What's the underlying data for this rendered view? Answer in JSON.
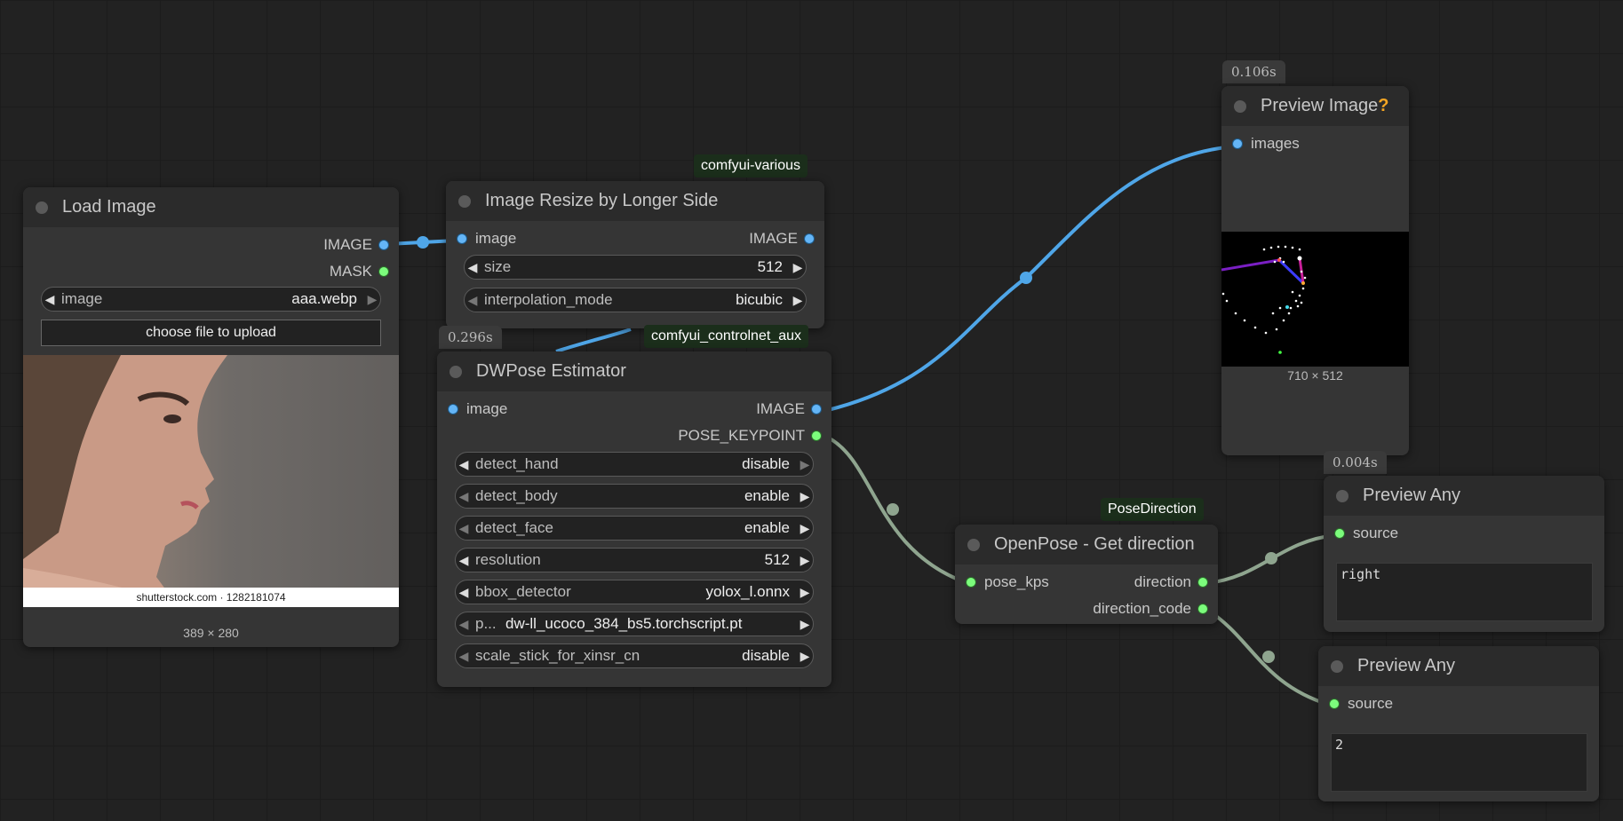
{
  "colors": {
    "image_link": "#4fa6e8",
    "pose_link": "#8fa58f",
    "node_bg": "#353535",
    "title_bg": "#2b2b2b",
    "canvas_bg": "#222222"
  },
  "nodes": {
    "load_image": {
      "title": "Load Image",
      "outputs": [
        "IMAGE",
        "MASK"
      ],
      "widget_image": {
        "label": "image",
        "value": "aaa.webp"
      },
      "upload_label": "choose file to upload",
      "watermark": "shutterstock.com · 1282181074",
      "dims": "389 × 280"
    },
    "image_resize": {
      "badge": "comfyui-various",
      "title": "Image Resize by Longer Side",
      "input": "image",
      "output": "IMAGE",
      "widgets": [
        {
          "label": "size",
          "value": "512"
        },
        {
          "label": "interpolation_mode",
          "value": "bicubic"
        }
      ]
    },
    "dwpose": {
      "timing": "0.296s",
      "badge": "comfyui_controlnet_aux",
      "title": "DWPose Estimator",
      "input": "image",
      "outputs": [
        "IMAGE",
        "POSE_KEYPOINT"
      ],
      "widgets": [
        {
          "label": "detect_hand",
          "value": "disable"
        },
        {
          "label": "detect_body",
          "value": "enable"
        },
        {
          "label": "detect_face",
          "value": "enable"
        },
        {
          "label": "resolution",
          "value": "512"
        },
        {
          "label": "bbox_detector",
          "value": "yolox_l.onnx"
        },
        {
          "label": "p...",
          "value": "dw-ll_ucoco_384_bs5.torchscript.pt"
        },
        {
          "label": "scale_stick_for_xinsr_cn",
          "value": "disable"
        }
      ]
    },
    "preview_image": {
      "timing": "0.106s",
      "title": "Preview Image",
      "help": "?",
      "input": "images",
      "dims": "710 × 512"
    },
    "openpose_direction": {
      "badge": "PoseDirection",
      "title": "OpenPose - Get direction",
      "input": "pose_kps",
      "outputs": [
        "direction",
        "direction_code"
      ]
    },
    "preview_any_1": {
      "timing": "0.004s",
      "title": "Preview Any",
      "input": "source",
      "value": "right"
    },
    "preview_any_2": {
      "title": "Preview Any",
      "input": "source",
      "value": "2"
    }
  }
}
